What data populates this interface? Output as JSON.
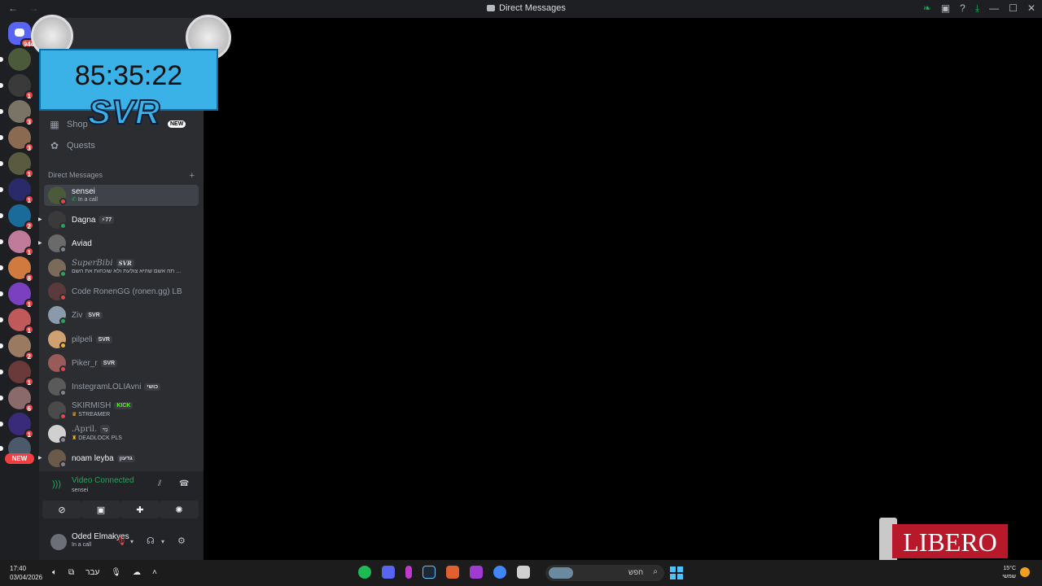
{
  "window": {
    "title": "Direct Messages",
    "nav_back": "←",
    "nav_forward": "→"
  },
  "guild_badges": [
    "944",
    "1",
    "3",
    "3",
    "1",
    "1",
    "2",
    "1",
    "8",
    "1",
    "1",
    "2",
    "1",
    "6",
    "1",
    "1"
  ],
  "guild_new_label": "NEW",
  "sidebar": {
    "shop_label": "Shop",
    "shop_new": "NEW",
    "quests_label": "Quests",
    "dm_header": "Direct Messages",
    "dm_add": "+"
  },
  "dms": [
    {
      "name": "sensei",
      "sub": "In a call",
      "tag": "",
      "status": "#f23f42"
    },
    {
      "name": "Dagna",
      "sub": "",
      "tag": "⚡77",
      "status": "#23a55a"
    },
    {
      "name": "Aviad",
      "sub": "",
      "tag": "",
      "status": "#80848e"
    },
    {
      "name": "SuperBibi",
      "sub": "תה אשם שהיא צולעת ולא שוכחות את השם ...",
      "tag": "SVR",
      "status": "#23a55a"
    },
    {
      "name": "Code RonenGG (ronen.gg) LB",
      "sub": "",
      "tag": "",
      "status": "#f23f42"
    },
    {
      "name": "Ziv",
      "sub": "",
      "tag": "SVR",
      "status": "#23a55a"
    },
    {
      "name": "pilpeli",
      "sub": "",
      "tag": "SVR",
      "status": "#f0b232"
    },
    {
      "name": "Piker_r",
      "sub": "",
      "tag": "SVR",
      "status": "#f23f42"
    },
    {
      "name": "InstegramLOLIAvni",
      "sub": "",
      "tag": "כושי",
      "status": "#80848e"
    },
    {
      "name": "SKIRMISH",
      "sub": "STREAMER",
      "tag": "KICK",
      "status": "#f23f42"
    },
    {
      "name": ".April.",
      "sub": "DEADLOCK PLS",
      "tag": "גזי",
      "status": "#80848e"
    },
    {
      "name": "noam leyba",
      "sub": "",
      "tag": "גדעון",
      "status": "#80848e"
    }
  ],
  "voice": {
    "status": "Video Connected",
    "channel": "sensei"
  },
  "user": {
    "name": "Oded Elmakyes",
    "status": "In a call"
  },
  "overlay": {
    "timer": "85:35:22",
    "brand": "SVR"
  },
  "taskbar": {
    "time": "17:40",
    "date": "03/04/2026",
    "lang": "עבר",
    "search_text": "חפש",
    "temp": "15°C",
    "weather_text": "שמשי"
  },
  "ad": {
    "brand": "LIBERO"
  }
}
